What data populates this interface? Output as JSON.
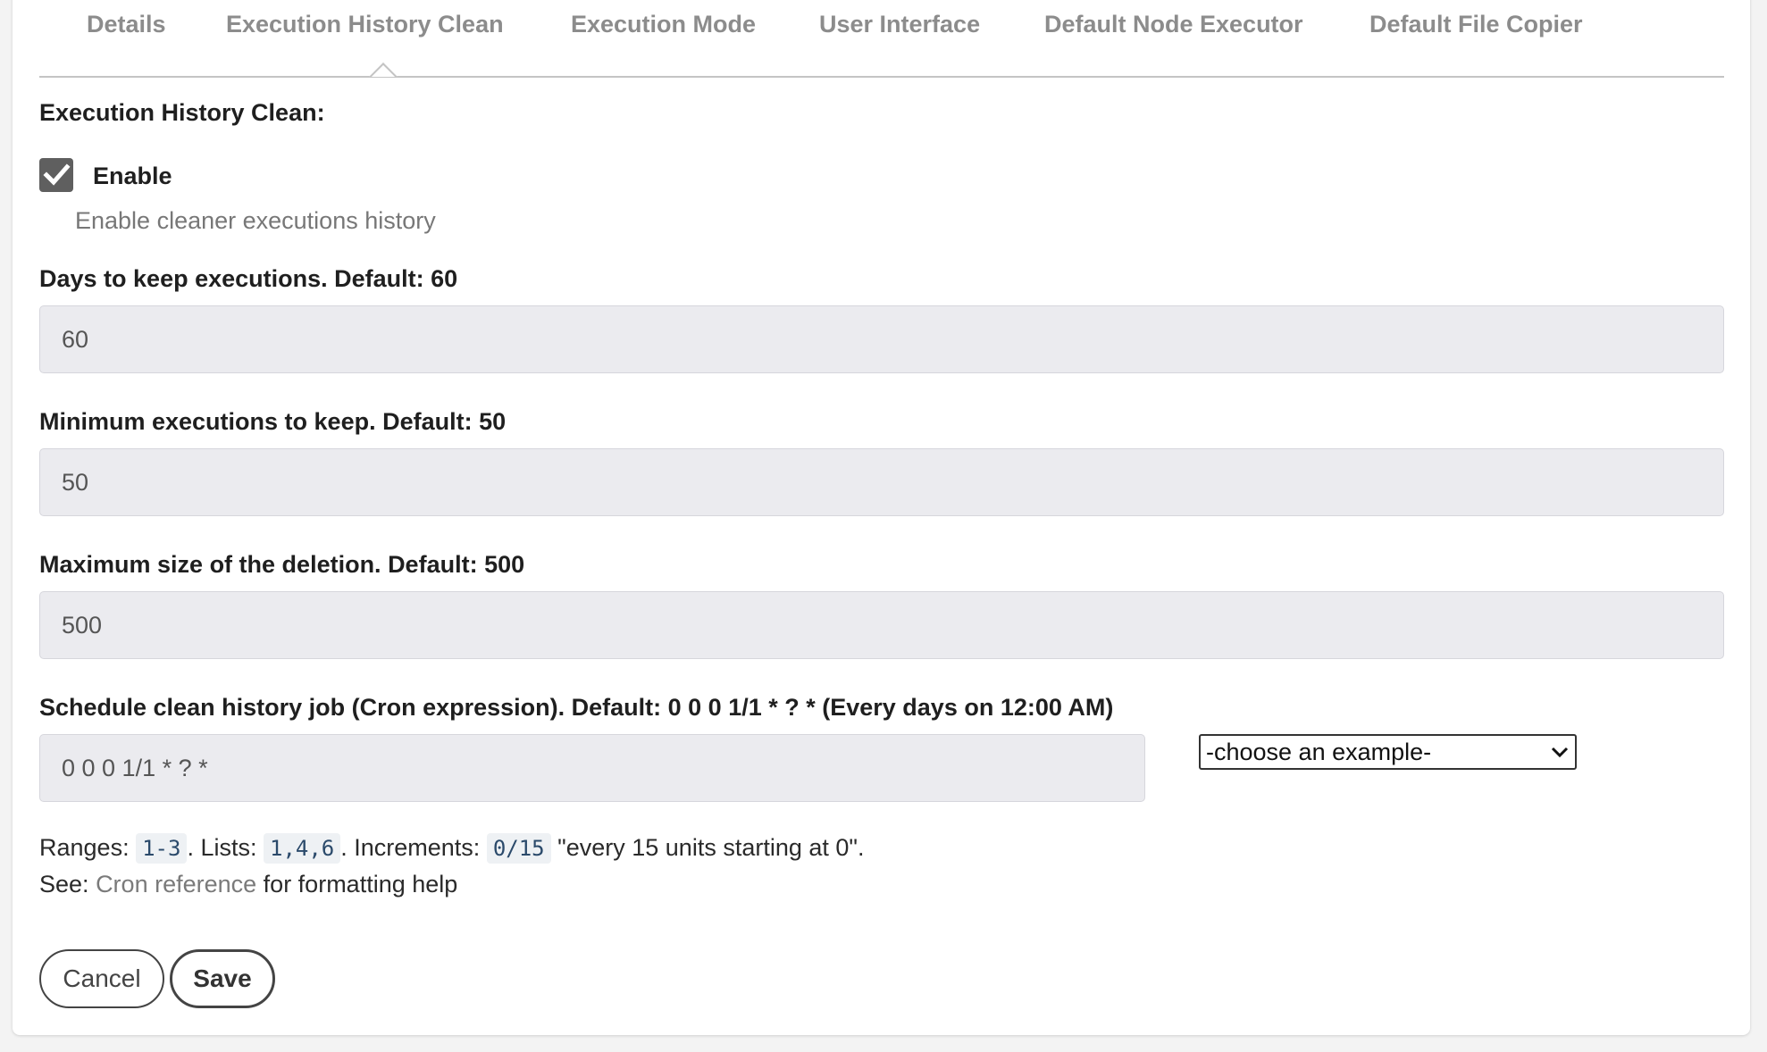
{
  "tabs": [
    {
      "label": "Details"
    },
    {
      "label": "Execution History Clean",
      "active": true
    },
    {
      "label": "Execution Mode"
    },
    {
      "label": "User Interface"
    },
    {
      "label": "Default Node Executor"
    },
    {
      "label": "Default File Copier"
    }
  ],
  "section": {
    "heading": "Execution History Clean:"
  },
  "enable": {
    "label": "Enable",
    "checked": true,
    "help": "Enable cleaner executions history"
  },
  "days_to_keep": {
    "label": "Days to keep executions. Default: 60",
    "value": "60"
  },
  "min_executions": {
    "label": "Minimum executions to keep. Default: 50",
    "value": "50"
  },
  "max_deletion": {
    "label": "Maximum size of the deletion. Default: 500",
    "value": "500"
  },
  "schedule": {
    "label": "Schedule clean history job (Cron expression). Default: 0 0 0 1/1 * ? * (Every days on 12:00 AM)",
    "value": "0 0 0 1/1 * ? *",
    "example_select": "-choose an example-"
  },
  "cron_help": {
    "ranges_label": "Ranges:",
    "ranges_code": "1-3",
    "lists_label": ". Lists:",
    "lists_code": "1,4,6",
    "increments_label": ". Increments:",
    "increments_code": "0/15",
    "increments_desc": "\"every 15 units starting at 0\".",
    "see_label": "See:",
    "see_link": "Cron reference",
    "see_suffix": "for formatting help"
  },
  "buttons": {
    "cancel": "Cancel",
    "save": "Save"
  },
  "colors": {
    "checkbox": "#5f5f5f",
    "field_bg": "#ebebef",
    "tab_text": "#8c8c8c"
  }
}
